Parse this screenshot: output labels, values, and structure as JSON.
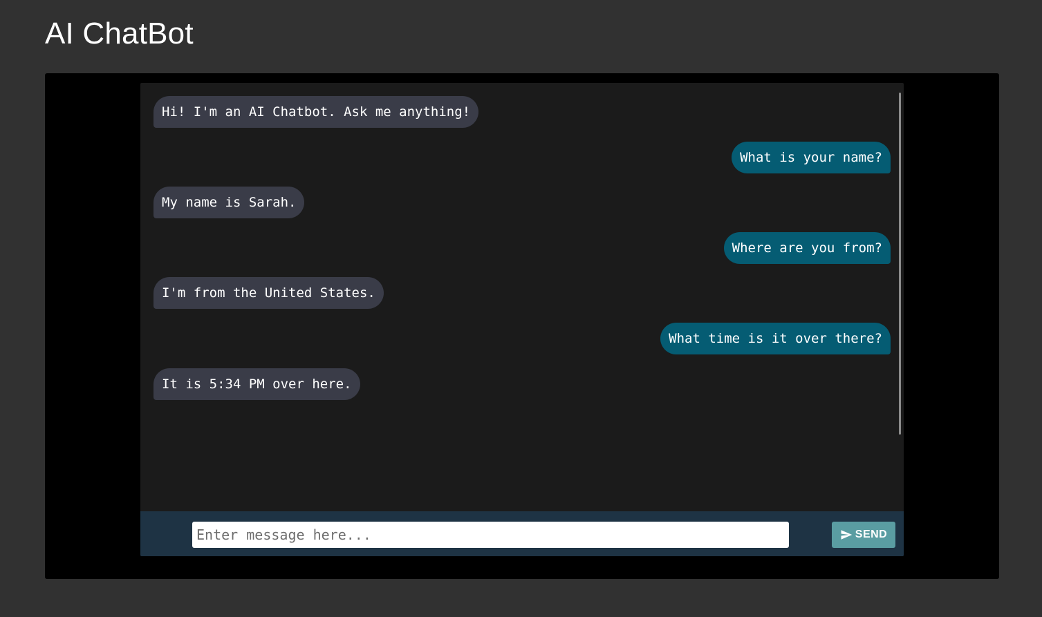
{
  "app": {
    "title": "AI ChatBot"
  },
  "messages": [
    {
      "sender": "bot",
      "text": "Hi! I'm an AI Chatbot. Ask me anything!"
    },
    {
      "sender": "user",
      "text": "What is your name?"
    },
    {
      "sender": "bot",
      "text": "My name is Sarah."
    },
    {
      "sender": "user",
      "text": "Where are you from?"
    },
    {
      "sender": "bot",
      "text": "I'm from the United States."
    },
    {
      "sender": "user",
      "text": "What time is it over there?"
    },
    {
      "sender": "bot",
      "text": "It is 5:34 PM over here."
    }
  ],
  "composer": {
    "placeholder": "Enter message here...",
    "value": "",
    "send_label": "SEND",
    "send_icon": "send-icon"
  },
  "colors": {
    "page_background": "#313131",
    "bot_bubble": "#3a3c48",
    "user_bubble": "#055c73",
    "input_bar": "#1e3344",
    "send_button": "#5a9da2"
  }
}
